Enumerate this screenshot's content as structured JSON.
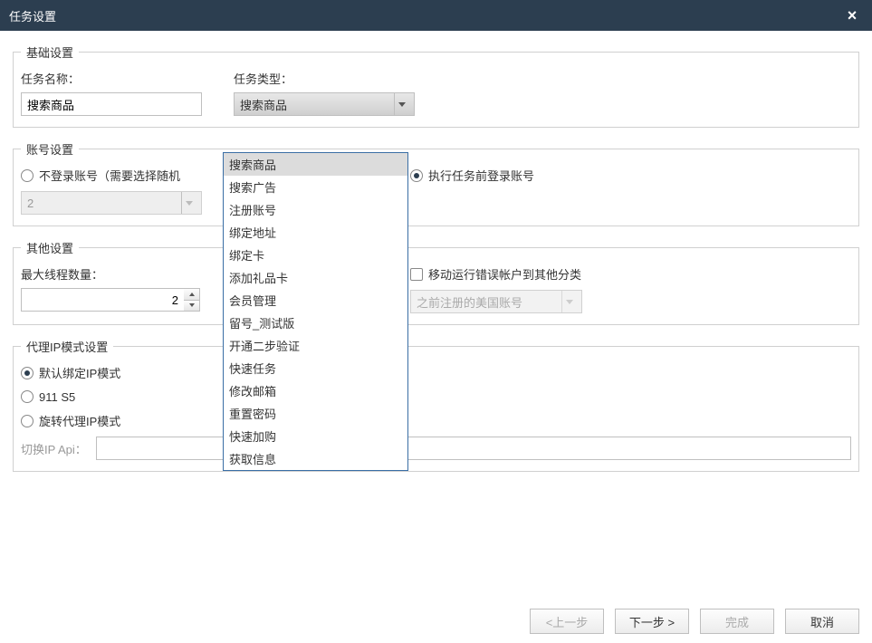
{
  "window": {
    "title": "任务设置"
  },
  "basic": {
    "legend": "基础设置",
    "taskNameLabel": "任务名称：",
    "taskTypeLabel": "任务类型：",
    "taskNameValue": "搜索商品",
    "taskTypeSelected": "搜索商品",
    "taskTypeOptions": [
      "搜索商品",
      "搜索广告",
      "注册账号",
      "绑定地址",
      "绑定卡",
      "添加礼品卡",
      "会员管理",
      "留号_测试版",
      "开通二步验证",
      "快速任务",
      "修改邮箱",
      "重置密码",
      "快速加购",
      "获取信息"
    ]
  },
  "account": {
    "legend": "账号设置",
    "opt1": "不登录账号（需要选择随机",
    "opt2": "执行任务前登录账号",
    "selected": "opt2",
    "comboValue": "2"
  },
  "other": {
    "legend": "其他设置",
    "maxThreadLabel": "最大线程数量：",
    "maxThreadValue": "2",
    "moveErrorLabel": "移动运行错误帐户到其他分类",
    "moveErrorCombo": "之前注册的美国账号"
  },
  "proxy": {
    "legend": "代理IP模式设置",
    "opt1": "默认绑定IP模式",
    "opt2": "911 S5",
    "opt3": "旋转代理IP模式",
    "selected": "opt1",
    "apiLabel": "切换IP Api："
  },
  "footer": {
    "prev": "<上一步",
    "next": "下一步 >",
    "finish": "完成",
    "cancel": "取消"
  }
}
